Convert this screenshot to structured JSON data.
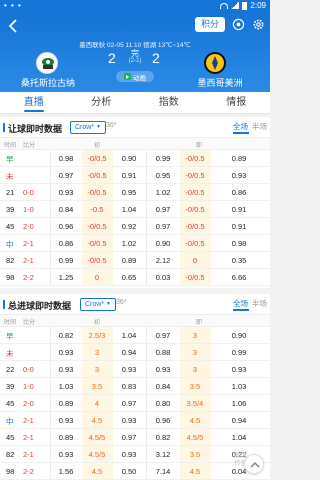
{
  "status_bar": {
    "left": "• • •",
    "time": "2:09"
  },
  "header": {
    "points_label": "积分",
    "league": "墨西联秋 02-05 11:10 德湖 13℃~14℃",
    "home_team": "桑托斯拉古纳",
    "away_team": "墨西哥美洲",
    "home_score": "2",
    "away_score": "2",
    "status": "完",
    "half_score": "(2-1)",
    "anim_label": "动画"
  },
  "tabs": [
    {
      "label": "直播",
      "active": true
    },
    {
      "label": "分析",
      "active": false
    },
    {
      "label": "指数",
      "active": false
    },
    {
      "label": "情报",
      "active": false
    }
  ],
  "handicap": {
    "title": "让球即时数据",
    "crow_label": "Crow*",
    "crow_num": "36*",
    "seg_full": "全场",
    "seg_half": "半场",
    "columns": {
      "time": "时间",
      "score": "比分",
      "mid": "初",
      "right": "即"
    },
    "rows": [
      {
        "time": "早",
        "score": "",
        "v": [
          "0.98",
          "-0/0.5",
          "0.90",
          "0.99",
          "-0/0.5",
          "0.89"
        ],
        "tc": "green"
      },
      {
        "time": "未",
        "score": "",
        "v": [
          "0.97",
          "-0/0.5",
          "0.91",
          "0.95",
          "-0/0.5",
          "0.93"
        ],
        "tc": "red"
      },
      {
        "time": "21",
        "score": "0-0",
        "v": [
          "0.93",
          "-0/0.5",
          "0.95",
          "1.02",
          "-0/0.5",
          "0.86"
        ],
        "tc": ""
      },
      {
        "time": "39",
        "score": "1-0",
        "v": [
          "0.84",
          "-0.5",
          "1.04",
          "0.97",
          "-0/0.5",
          "0.91"
        ],
        "tc": ""
      },
      {
        "time": "45",
        "score": "2-0",
        "v": [
          "0.96",
          "-0/0.5",
          "0.92",
          "0.97",
          "-0/0.5",
          "0.91"
        ],
        "tc": ""
      },
      {
        "time": "中",
        "score": "2-1",
        "v": [
          "0.86",
          "-0/0.5",
          "1.02",
          "0.90",
          "-0/0.5",
          "0.98"
        ],
        "tc": "blue"
      },
      {
        "time": "82",
        "score": "2-1",
        "v": [
          "0.99",
          "-0/0.5",
          "0.89",
          "2.12",
          "0",
          "0.35"
        ],
        "tc": ""
      },
      {
        "time": "98",
        "score": "2-2",
        "v": [
          "1.25",
          "0",
          "0.65",
          "0.03",
          "-0/0.5",
          "6.66"
        ],
        "tc": ""
      }
    ]
  },
  "total": {
    "title": "总进球即时数据",
    "crow_label": "Crow*",
    "crow_num": "36*",
    "seg_full": "全场",
    "seg_half": "半场",
    "columns": {
      "time": "时间",
      "score": "比分",
      "mid": "初",
      "right": "即"
    },
    "rows": [
      {
        "time": "早",
        "score": "",
        "v": [
          "0.82",
          "2.5/3",
          "1.04",
          "0.97",
          "3",
          "0.90"
        ],
        "tc": "green"
      },
      {
        "time": "未",
        "score": "",
        "v": [
          "0.93",
          "3",
          "0.94",
          "0.88",
          "3",
          "0.99"
        ],
        "tc": "red"
      },
      {
        "time": "22",
        "score": "0-0",
        "v": [
          "0.93",
          "3",
          "0.93",
          "0.93",
          "3",
          "0.93"
        ],
        "tc": ""
      },
      {
        "time": "39",
        "score": "1-0",
        "v": [
          "1.03",
          "3.5",
          "0.83",
          "0.84",
          "3.5",
          "1.03"
        ],
        "tc": ""
      },
      {
        "time": "45",
        "score": "2-0",
        "v": [
          "0.89",
          "4",
          "0.97",
          "0.80",
          "3.5/4",
          "1.06"
        ],
        "tc": ""
      },
      {
        "time": "中",
        "score": "2-1",
        "v": [
          "0.93",
          "4.5",
          "0.93",
          "0.96",
          "4.5",
          "0.94"
        ],
        "tc": "blue"
      },
      {
        "time": "45",
        "score": "2-1",
        "v": [
          "0.89",
          "4.5/5",
          "0.97",
          "0.82",
          "4.5/5",
          "1.04"
        ],
        "tc": ""
      },
      {
        "time": "82",
        "score": "2-1",
        "v": [
          "0.93",
          "4.5/5",
          "0.93",
          "3.12",
          "3.5",
          "0.22"
        ],
        "tc": ""
      },
      {
        "time": "98",
        "score": "2-2",
        "v": [
          "1.56",
          "4.5",
          "0.50",
          "7.14",
          "4.5",
          "0.04"
        ],
        "tc": ""
      }
    ]
  },
  "watermark": "激活\n转到"
}
